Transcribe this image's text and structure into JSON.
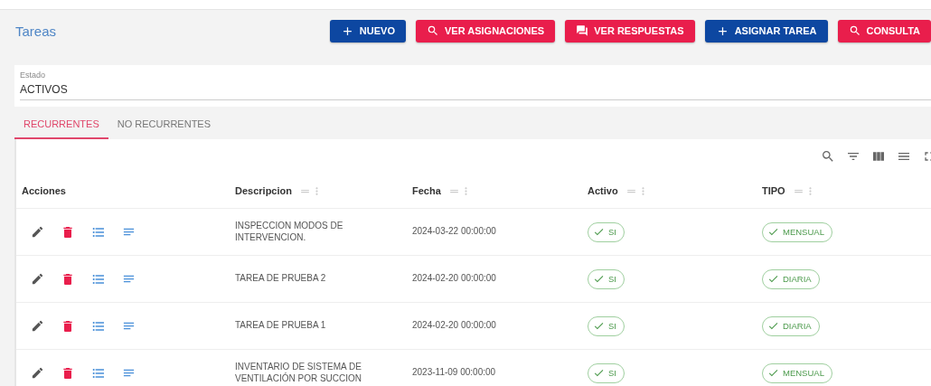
{
  "page": {
    "title": "Tareas"
  },
  "buttons": [
    {
      "label": "NUEVO",
      "kind": "add",
      "color": "#0d47a1"
    },
    {
      "label": "VER ASIGNACIONES",
      "kind": "search",
      "color": "#e91e4c"
    },
    {
      "label": "VER RESPUESTAS",
      "kind": "chat",
      "color": "#e91e4c"
    },
    {
      "label": "ASIGNAR TAREA",
      "kind": "add",
      "color": "#0d47a1"
    },
    {
      "label": "CONSULTA",
      "kind": "search",
      "color": "#e91e4c"
    }
  ],
  "filter": {
    "label": "Estado",
    "value": "ACTIVOS"
  },
  "tabs": [
    {
      "label": "RECURRENTES",
      "selected": true
    },
    {
      "label": "NO RECURRENTES",
      "selected": false
    }
  ],
  "table": {
    "columns": [
      {
        "label": "Acciones",
        "kind": "actions"
      },
      {
        "label": "Descripcion",
        "kind": "data"
      },
      {
        "label": "Fecha",
        "kind": "data"
      },
      {
        "label": "Activo",
        "kind": "data"
      },
      {
        "label": "TIPO",
        "kind": "data"
      }
    ],
    "rows": [
      {
        "descripcion": "INSPECCION MODOS DE INTERVENCION.",
        "fecha": "2024-03-22 00:00:00",
        "activo": "SI",
        "tipo": "MENSUAL"
      },
      {
        "descripcion": "TAREA DE PRUEBA 2",
        "fecha": "2024-02-20 00:00:00",
        "activo": "SI",
        "tipo": "DIARIA"
      },
      {
        "descripcion": "TAREA DE PRUEBA 1",
        "fecha": "2024-02-20 00:00:00",
        "activo": "SI",
        "tipo": "DIARIA"
      },
      {
        "descripcion": "INVENTARIO DE SISTEMA DE VENTILACIÓN POR SUCCION",
        "fecha": "2023-11-09 00:00:00",
        "activo": "SI",
        "tipo": "MENSUAL"
      }
    ]
  }
}
